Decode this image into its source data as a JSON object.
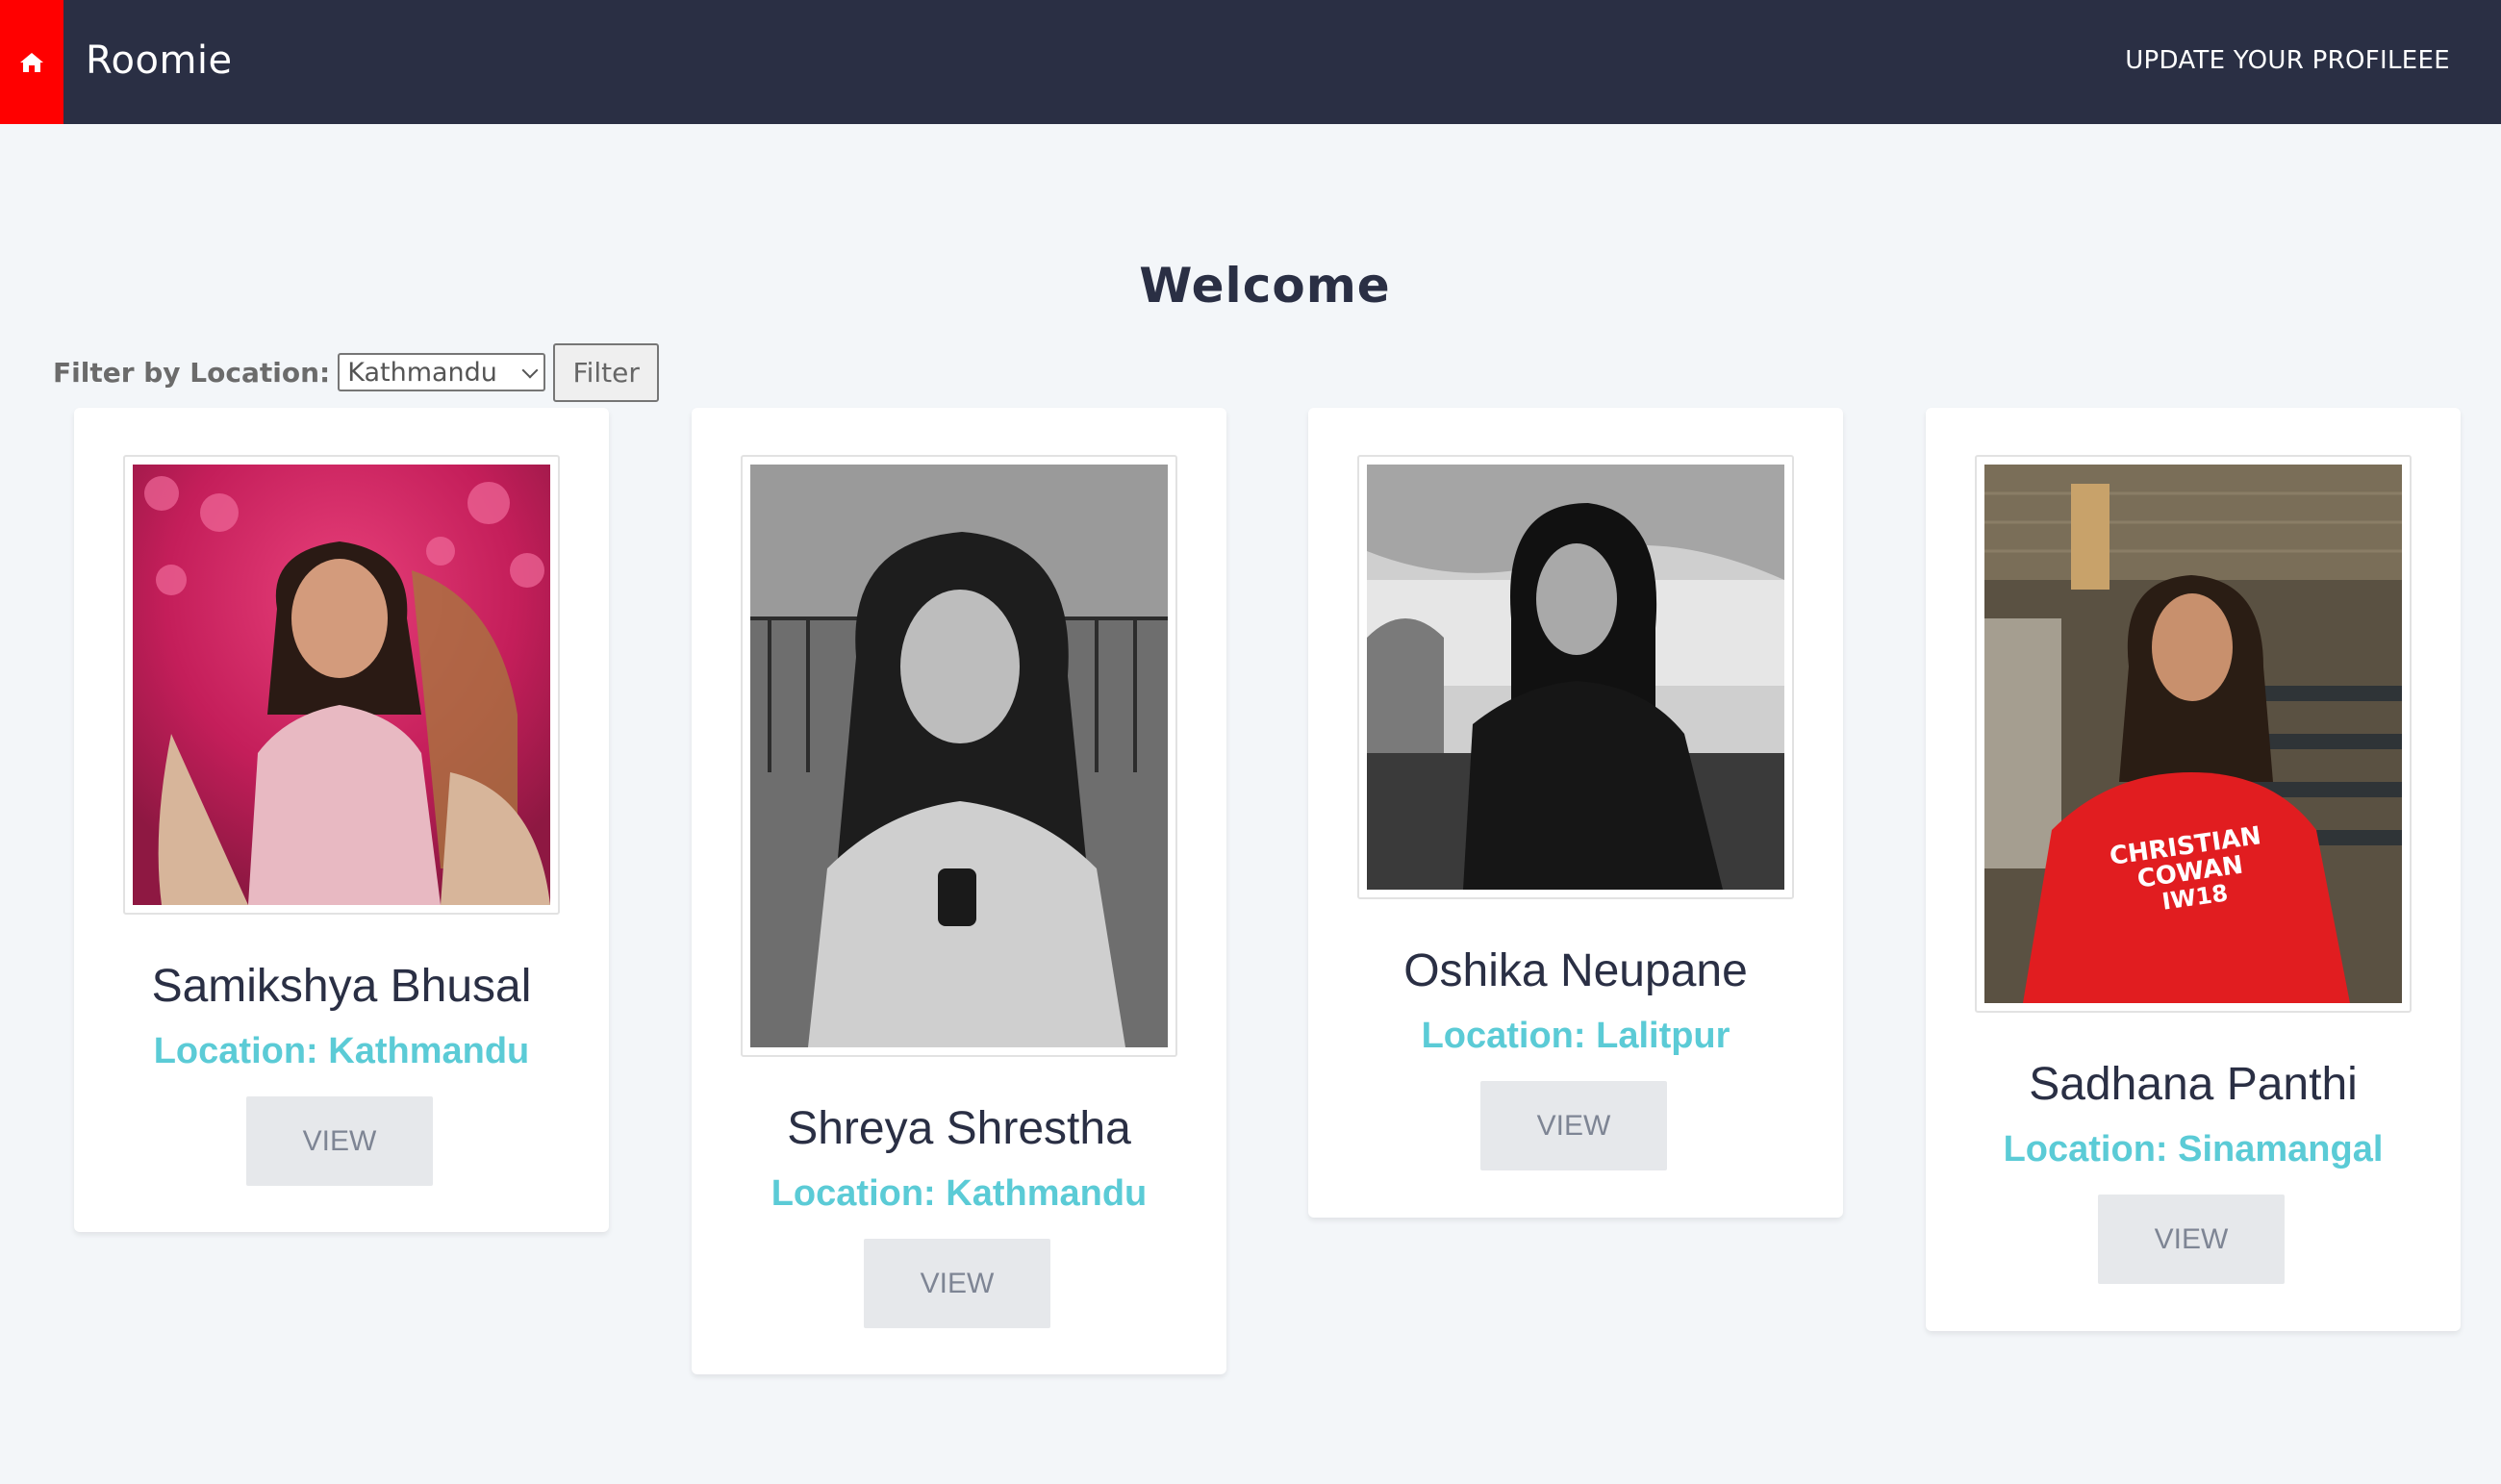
{
  "header": {
    "brand": "Roomie",
    "home_icon": "home-icon",
    "update_link": "UPDATE YOUR PROFILEEE"
  },
  "main": {
    "heading": "Welcome"
  },
  "filter": {
    "label": "Filter by Location:",
    "selected": "Kathmandu",
    "button": "Filter"
  },
  "cards": [
    {
      "name": "Samikshya Bhusal",
      "location": "Location: Kathmandu",
      "button": "VIEW"
    },
    {
      "name": "Shreya Shrestha",
      "location": "Location: Kathmandu",
      "button": "VIEW"
    },
    {
      "name": "Oshika Neupane",
      "location": "Location: Lalitpur",
      "button": "VIEW"
    },
    {
      "name": "Sadhana Panthi",
      "location": "Location: Sinamangal",
      "button": "VIEW"
    }
  ],
  "colors": {
    "navbar": "#2a2f44",
    "home_button": "#ff0000",
    "accent": "#5bcbd6",
    "background": "#f3f6f9"
  }
}
